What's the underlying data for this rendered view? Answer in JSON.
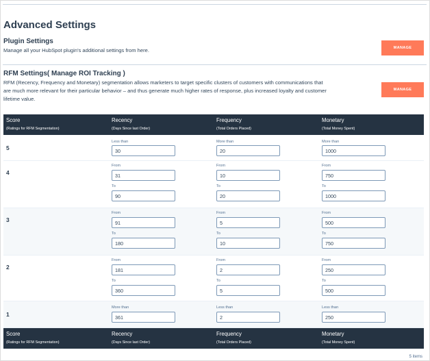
{
  "page": {
    "title": "Advanced Settings"
  },
  "plugin_settings": {
    "title": "Plugin Settings",
    "description": "Manage all your HubSpot plugin's additional settings from here.",
    "button_label": "MANAGE"
  },
  "rfm_settings": {
    "title": "RFM Settings( Manage ROI Tracking )",
    "description_line1": "RFM (Recency, Frequency and Monetary) segmentation allows marketers to target specific clusters of customers with communications that",
    "description_line2": "are much more relevant for their particular behavior – and thus generate much higher rates of response, plus increased loyalty and customer",
    "description_line3": "lifetime value.",
    "button_label": "MANAGE"
  },
  "table": {
    "columns": [
      {
        "title": "Score",
        "subtitle": "(Ratings for RFM Segmentation)"
      },
      {
        "title": "Recency",
        "subtitle": "(Days Since last Order)"
      },
      {
        "title": "Frequency",
        "subtitle": "(Total Orders Placed)"
      },
      {
        "title": "Monetary",
        "subtitle": "(Total Money Spent)"
      }
    ],
    "rows": [
      {
        "score": "5",
        "recency": {
          "label1": "Less than",
          "value1": "30"
        },
        "frequency": {
          "label1": "More than",
          "value1": "20"
        },
        "monetary": {
          "label1": "More than",
          "value1": "1000"
        }
      },
      {
        "score": "4",
        "recency": {
          "label1": "From",
          "value1": "31",
          "label2": "To",
          "value2": "90"
        },
        "frequency": {
          "label1": "From",
          "value1": "10",
          "label2": "To",
          "value2": "20"
        },
        "monetary": {
          "label1": "From",
          "value1": "750",
          "label2": "To",
          "value2": "1000"
        }
      },
      {
        "score": "3",
        "recency": {
          "label1": "From",
          "value1": "91",
          "label2": "To",
          "value2": "180"
        },
        "frequency": {
          "label1": "From",
          "value1": "5",
          "label2": "To",
          "value2": "10"
        },
        "monetary": {
          "label1": "From",
          "value1": "500",
          "label2": "To",
          "value2": "750"
        }
      },
      {
        "score": "2",
        "recency": {
          "label1": "From",
          "value1": "181",
          "label2": "To",
          "value2": "360"
        },
        "frequency": {
          "label1": "From",
          "value1": "2",
          "label2": "To",
          "value2": "5"
        },
        "monetary": {
          "label1": "From",
          "value1": "250",
          "label2": "To",
          "value2": "500"
        }
      },
      {
        "score": "1",
        "recency": {
          "label1": "More than",
          "value1": "361"
        },
        "frequency": {
          "label1": "Less than",
          "value1": "2"
        },
        "monetary": {
          "label1": "Less than",
          "value1": "250"
        }
      }
    ],
    "items_count": "5 items"
  },
  "colors": {
    "header_bg": "#253342",
    "accent": "#ff7a59",
    "alt_row": "#f5f8fa"
  }
}
